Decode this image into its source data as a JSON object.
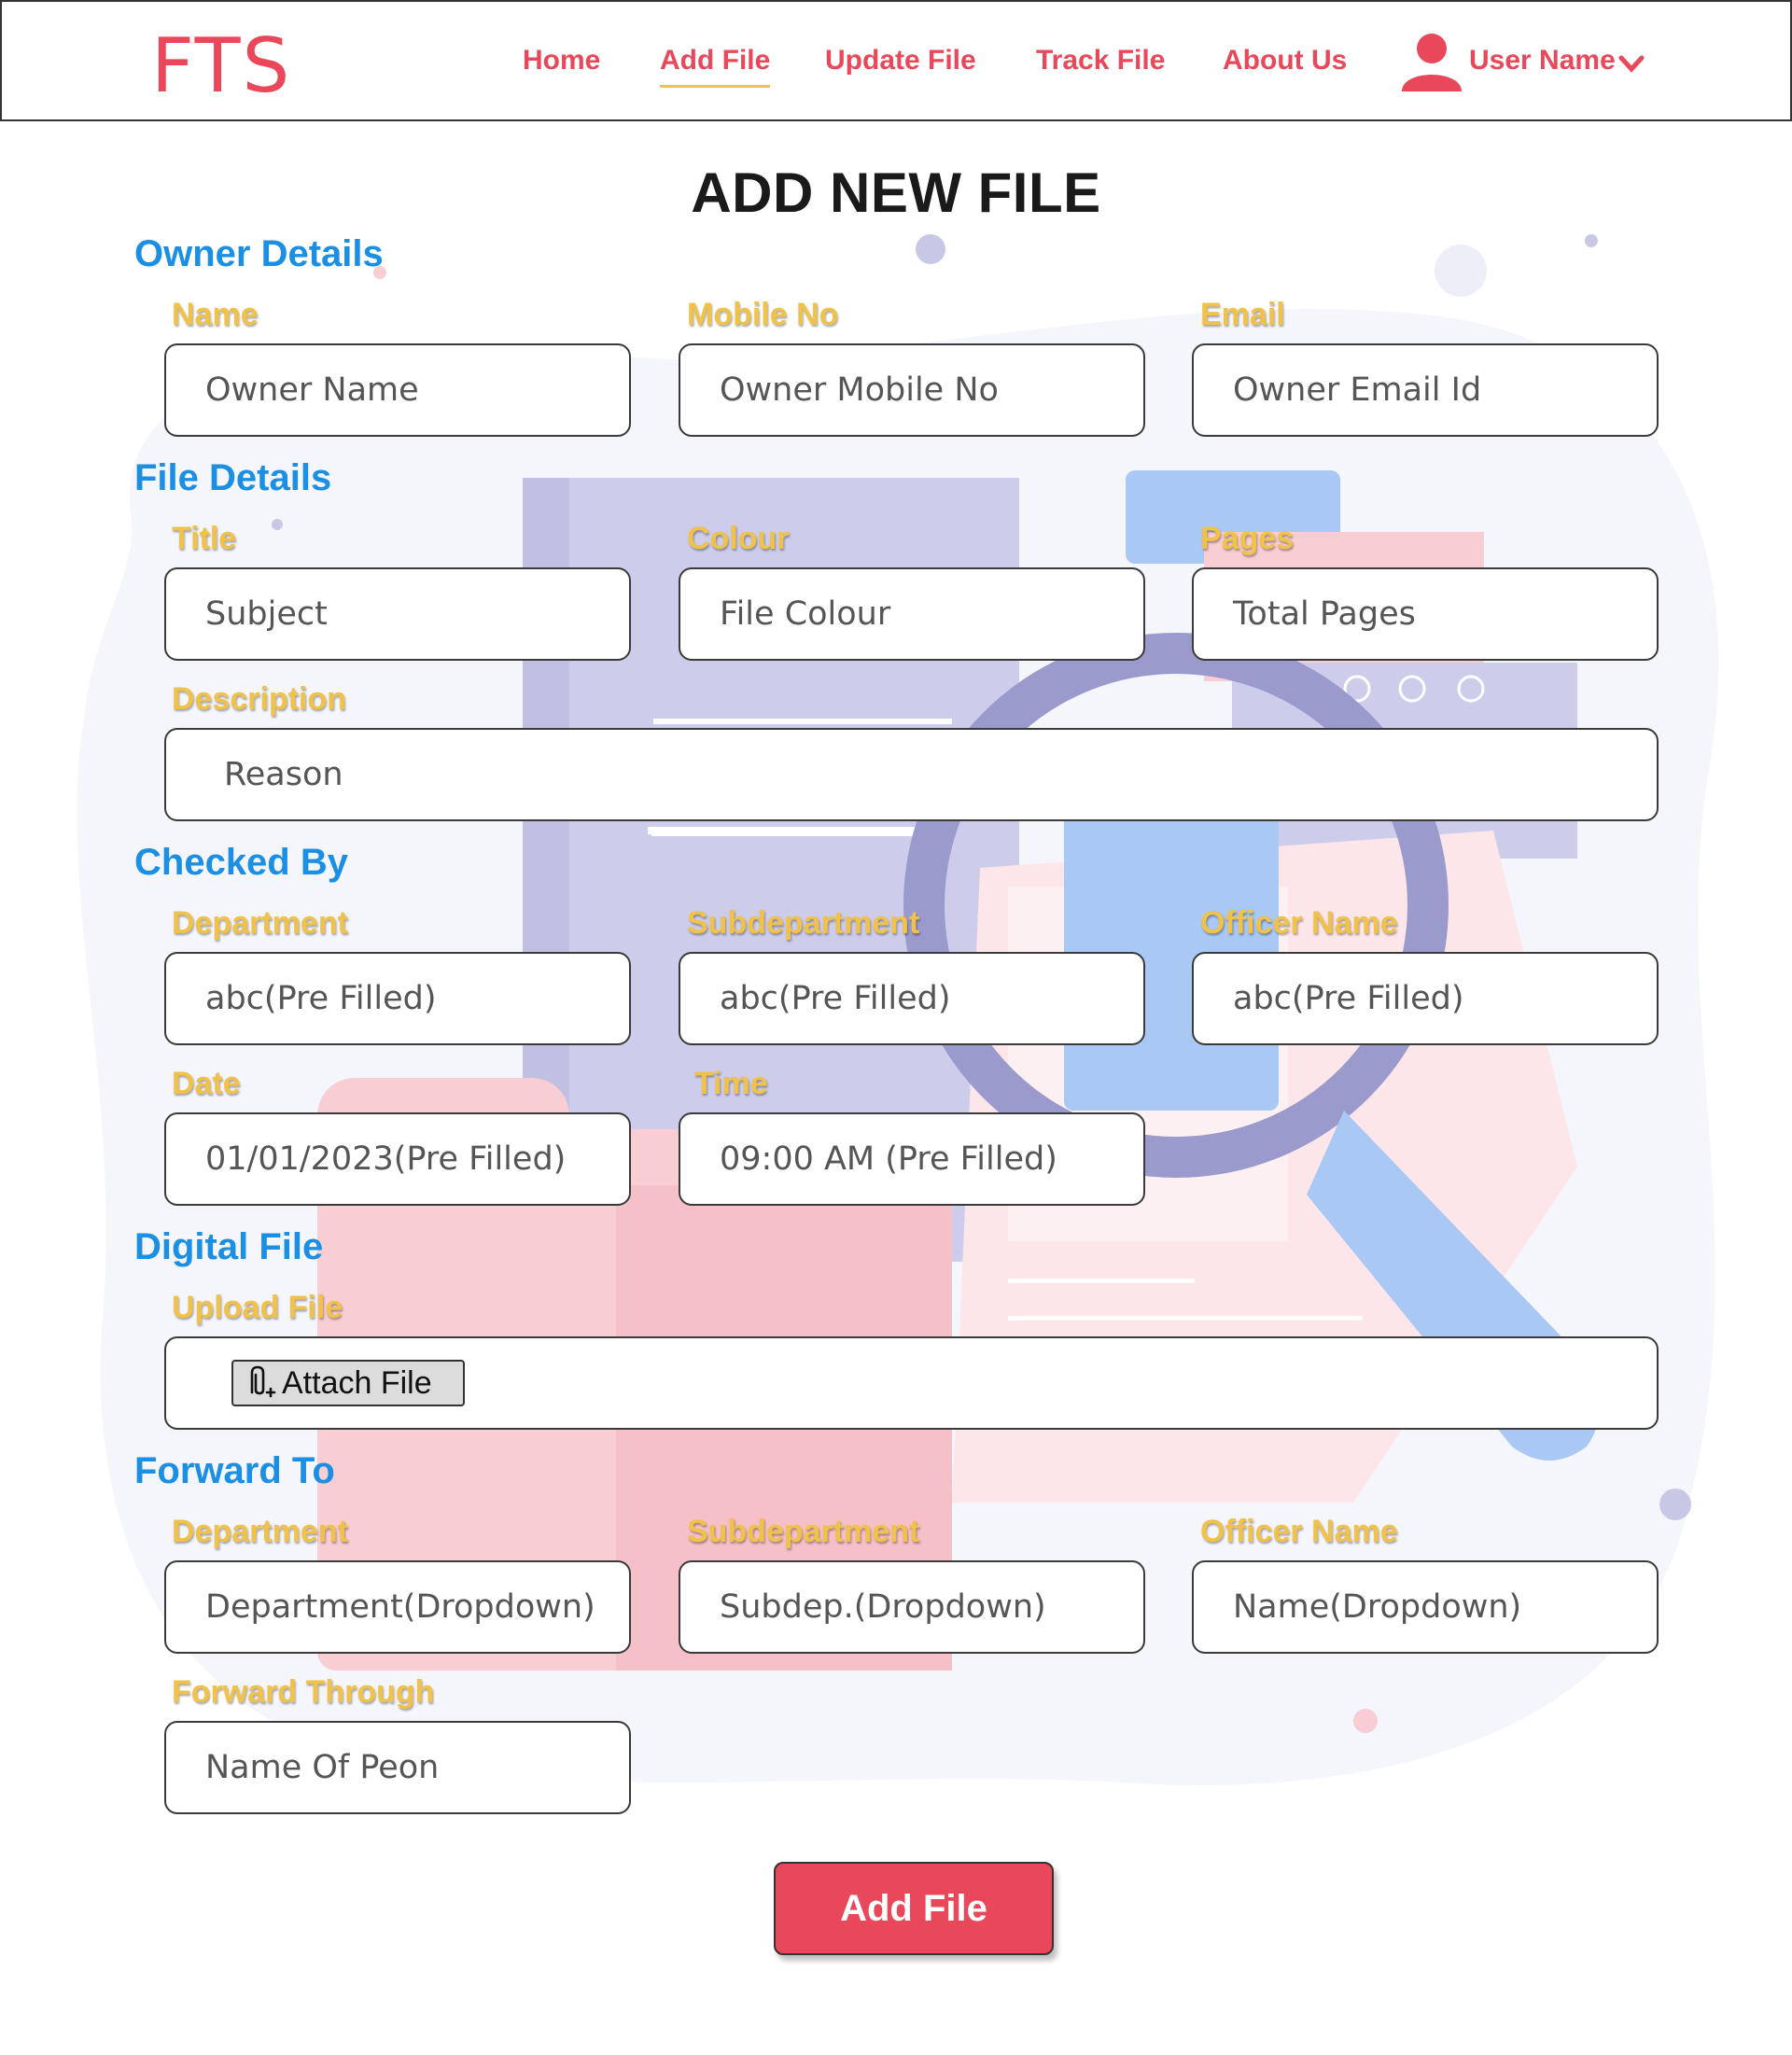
{
  "nav": {
    "logo": "FTS",
    "links": [
      "Home",
      "Add File",
      "Update File",
      "Track File",
      "About Us"
    ],
    "active": "Add File",
    "user_name": "User Name",
    "user_icon": "user-icon",
    "dropdown_icon": "chevron-down-icon"
  },
  "page": {
    "title": "ADD NEW FILE"
  },
  "owner": {
    "section_title": "Owner Details",
    "name_label": "Name",
    "name_placeholder": "Owner Name",
    "mobile_label": "Mobile No",
    "mobile_placeholder": "Owner Mobile No",
    "email_label": "Email",
    "email_placeholder": "Owner Email Id"
  },
  "file": {
    "section_title": "File Details",
    "title_label": "Title",
    "title_placeholder": "Subject",
    "colour_label": "Colour",
    "colour_placeholder": "File Colour",
    "pages_label": "Pages",
    "pages_placeholder": "Total Pages",
    "description_label": "Description",
    "description_placeholder": "Reason"
  },
  "checked": {
    "section_title": "Checked By",
    "department_label": "Department",
    "department_value": "abc(Pre Filled)",
    "subdepartment_label": "Subdepartment",
    "subdepartment_value": "abc(Pre Filled)",
    "officer_label": "Officer Name",
    "officer_value": "abc(Pre Filled)",
    "date_label": "Date",
    "date_value": "01/01/2023(Pre Filled)",
    "time_label": "Time",
    "time_value": "09:00 AM (Pre Filled)"
  },
  "digital": {
    "section_title": "Digital File",
    "upload_label": "Upload File",
    "attach_label": "Attach File",
    "attach_icon": "paperclip-icon"
  },
  "forward": {
    "section_title": "Forward To",
    "department_label": "Department",
    "department_placeholder": "Department(Dropdown)",
    "subdepartment_label": "Subdepartment",
    "subdepartment_placeholder": "Subdep.(Dropdown)",
    "officer_label": "Officer Name",
    "officer_placeholder": "Name(Dropdown)",
    "through_label": "Forward Through",
    "through_placeholder": "Name Of Peon"
  },
  "submit": {
    "label": "Add File"
  },
  "colors": {
    "brand": "#e8485a",
    "section_title": "#1a8fe3",
    "field_label": "#f0c24a",
    "active_underline": "#f0c24a"
  }
}
